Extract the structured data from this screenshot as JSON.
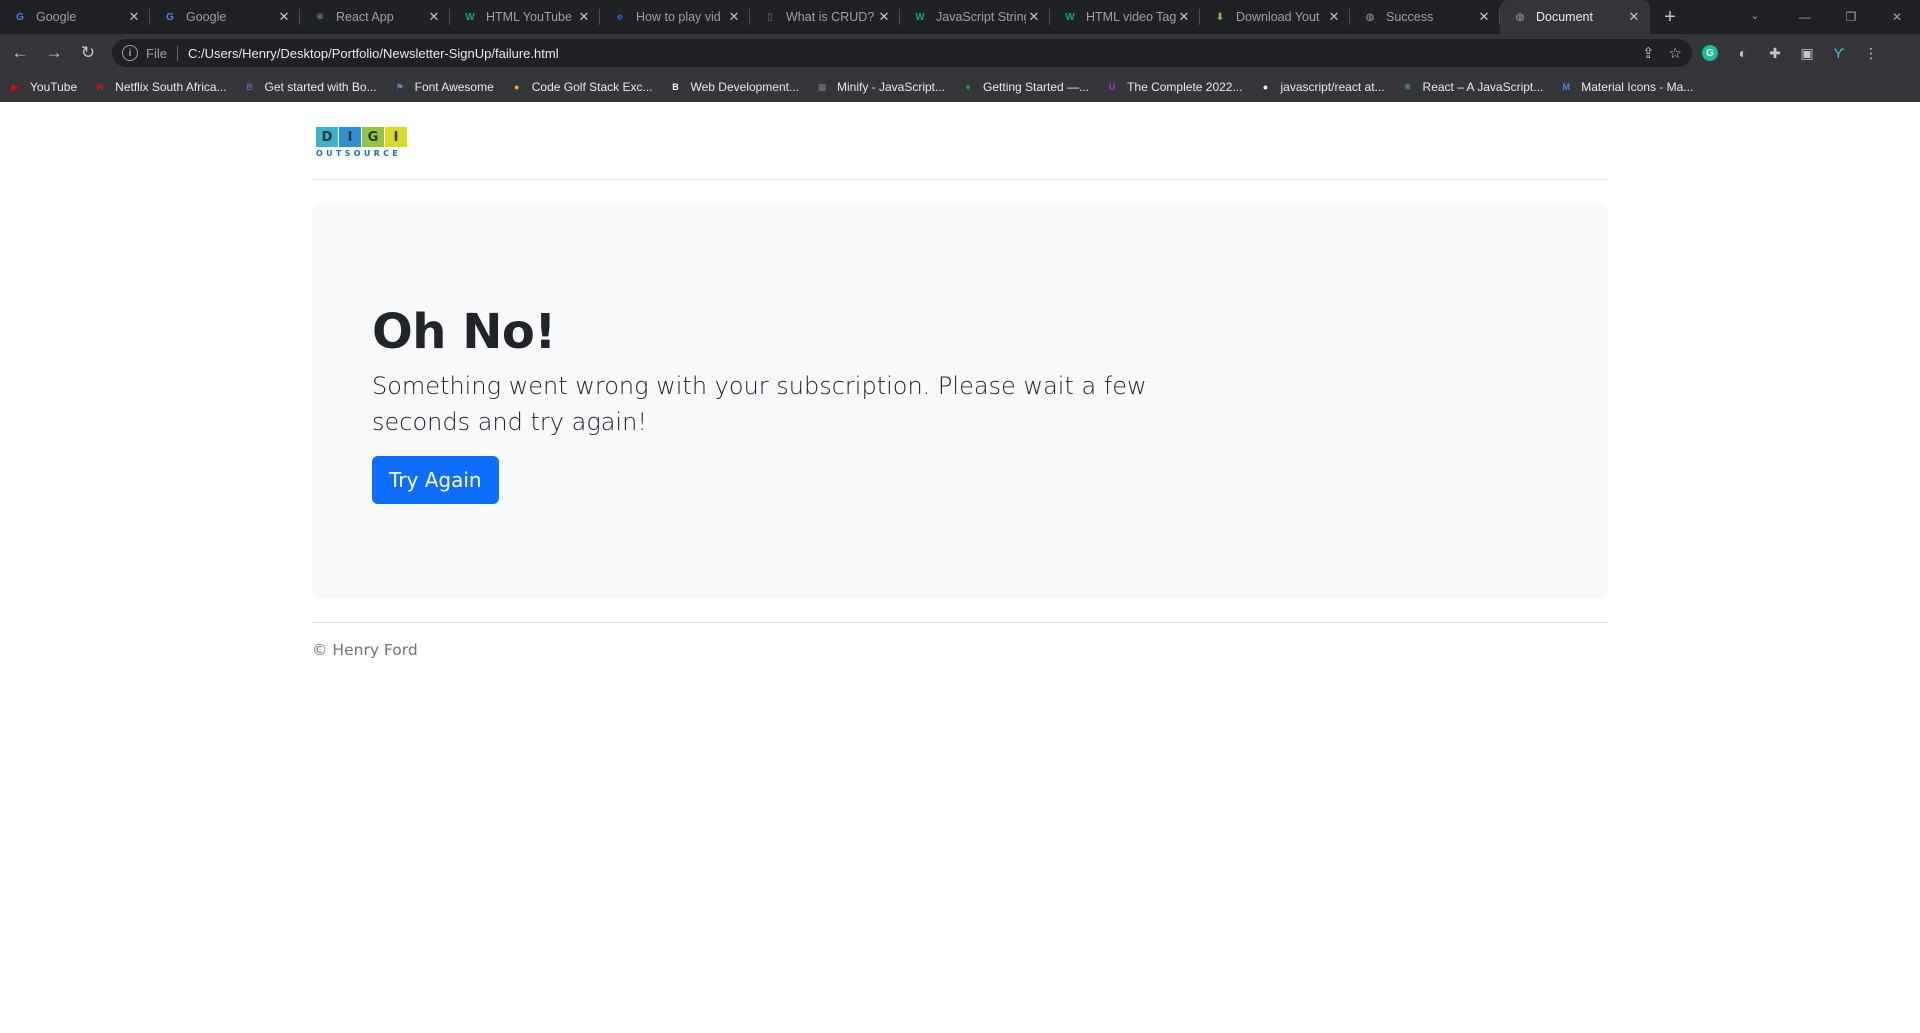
{
  "tabs": [
    {
      "title": "Google",
      "favicon": "google-icon",
      "color": "#4285f4",
      "glyph": "G"
    },
    {
      "title": "Google",
      "favicon": "google-icon",
      "color": "#4285f4",
      "glyph": "G"
    },
    {
      "title": "React App",
      "favicon": "react-icon",
      "color": "#61dafb",
      "glyph": "⚛"
    },
    {
      "title": "HTML YouTube",
      "favicon": "w3schools-icon",
      "color": "#04aa6d",
      "glyph": "W"
    },
    {
      "title": "How to play vid",
      "favicon": "edureka-icon",
      "color": "#1a73e8",
      "glyph": "e"
    },
    {
      "title": "What is CRUD?",
      "favicon": "document-icon",
      "color": "#5f6368",
      "glyph": "▯"
    },
    {
      "title": "JavaScript String",
      "favicon": "w3schools-icon",
      "color": "#04aa6d",
      "glyph": "W"
    },
    {
      "title": "HTML video Tag",
      "favicon": "w3schools-icon",
      "color": "#04aa6d",
      "glyph": "W"
    },
    {
      "title": "Download Yout",
      "favicon": "download-icon",
      "color": "#8bc34a",
      "glyph": "⬇"
    },
    {
      "title": "Success",
      "favicon": "globe-icon",
      "color": "#9aa0a6",
      "glyph": "◍"
    },
    {
      "title": "Document",
      "favicon": "globe-icon",
      "color": "#9aa0a6",
      "glyph": "◍",
      "active": true
    }
  ],
  "omnibox": {
    "scheme": "File",
    "url": "C:/Users/Henry/Desktop/Portfolio/Newsletter-SignUp/failure.html"
  },
  "bookmarks": [
    {
      "label": "YouTube",
      "icon": "youtube-icon",
      "color": "#ff0000",
      "glyph": "▶"
    },
    {
      "label": "Netflix South Africa...",
      "icon": "netflix-icon",
      "color": "#e50914",
      "glyph": "N"
    },
    {
      "label": "Get started with Bo...",
      "icon": "bootstrap-icon",
      "color": "#7952b3",
      "glyph": "B"
    },
    {
      "label": "Font Awesome",
      "icon": "flag-icon",
      "color": "#528dd7",
      "glyph": "⚑"
    },
    {
      "label": "Code Golf Stack Exc...",
      "icon": "medal-icon",
      "color": "#f2b705",
      "glyph": "●"
    },
    {
      "label": "Web Development...",
      "icon": "udemy-icon",
      "color": "#ffffff",
      "glyph": "B"
    },
    {
      "label": "Minify - JavaScript...",
      "icon": "minify-icon",
      "color": "#7a7a7a",
      "glyph": "▦"
    },
    {
      "label": "Getting Started —...",
      "icon": "mongodb-icon",
      "color": "#13aa52",
      "glyph": "♦"
    },
    {
      "label": "The Complete 2022...",
      "icon": "udemy-icon",
      "color": "#a435f0",
      "glyph": "U"
    },
    {
      "label": "javascript/react at...",
      "icon": "github-icon",
      "color": "#ffffff",
      "glyph": "●"
    },
    {
      "label": "React – A JavaScript...",
      "icon": "react-icon",
      "color": "#61dafb",
      "glyph": "⚛"
    },
    {
      "label": "Material Icons - Ma...",
      "icon": "material-icon",
      "color": "#4285f4",
      "glyph": "M"
    }
  ],
  "logo": {
    "letters": [
      {
        "char": "D",
        "color": "#3bb4c9"
      },
      {
        "char": "I",
        "color": "#2f8fd0"
      },
      {
        "char": "G",
        "color": "#8fc73e"
      },
      {
        "char": "I",
        "color": "#d9d92a"
      }
    ],
    "tagline": "OUTSOURCE"
  },
  "main": {
    "heading": "Oh No!",
    "message": "Something went wrong with your subscription. Please wait a few seconds and try again!",
    "button_label": "Try Again"
  },
  "footer": {
    "copyright": "© Henry Ford"
  },
  "colors": {
    "primary": "#0d6efd",
    "jumbotron_bg": "#f8f9fa",
    "text": "#212529",
    "muted": "#6c757d"
  }
}
